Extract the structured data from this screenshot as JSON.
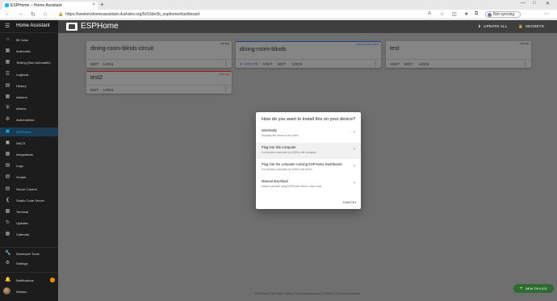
{
  "browser": {
    "tab_title": "ESPHome – Home Assistant",
    "tab_close": "×",
    "new_tab": "+",
    "url": "https://westonshomeassistant.duckdns.org/5c53de3b_esphome/dashboard",
    "sync_label": "Not syncing"
  },
  "sidebar": {
    "title": "Home Assistant",
    "items": [
      {
        "label": "Mi Casa",
        "icon": "home-icon"
      },
      {
        "label": "Automatic",
        "icon": "dashboard-icon"
      },
      {
        "label": "Testing (Non Automatic)",
        "icon": "dashboard-icon"
      },
      {
        "label": "Logbook",
        "icon": "logbook-icon"
      },
      {
        "label": "History",
        "icon": "history-icon"
      },
      {
        "label": "Addons",
        "icon": "dashboard-icon"
      },
      {
        "label": "Alarms",
        "icon": "shield-icon"
      },
      {
        "label": "Automations",
        "icon": "robot-icon"
      },
      {
        "label": "ESPHome",
        "icon": "esphome-icon"
      },
      {
        "label": "HACS",
        "icon": "hacs-icon"
      },
      {
        "label": "Integrations",
        "icon": "puzzle-icon"
      },
      {
        "label": "Logs",
        "icon": "logs-icon"
      },
      {
        "label": "Scripts",
        "icon": "script-icon"
      },
      {
        "label": "Server Control",
        "icon": "server-icon"
      },
      {
        "label": "Studio Code Server",
        "icon": "code-icon"
      },
      {
        "label": "Terminal",
        "icon": "terminal-icon"
      },
      {
        "label": "Updates",
        "icon": "update-icon"
      },
      {
        "label": "Calendar",
        "icon": "calendar-icon"
      }
    ],
    "developer_tools": "Developer Tools",
    "settings": "Settings",
    "notifications": "Notifications",
    "notification_count": "1",
    "user": "Weston"
  },
  "app": {
    "title": "ESPHome",
    "update_all": "UPDATE ALL",
    "secrets": "SECRETS"
  },
  "devices": [
    {
      "name": "dining-room-blinds-circuit",
      "status": "ONLINE",
      "actions": [
        "EDIT",
        "LOGS"
      ]
    },
    {
      "name": "dining-room-blinds",
      "status": "UPDATE AVAILABLE",
      "actions": [
        "UPDATE",
        "VISIT",
        "EDIT",
        "LOGS"
      ]
    },
    {
      "name": "test",
      "status": "ONLINE",
      "actions": [
        "VISIT",
        "EDIT",
        "LOGS"
      ]
    },
    {
      "name": "test2",
      "status": "OFFLINE",
      "actions": [
        "EDIT",
        "LOGS"
      ]
    }
  ],
  "footer": "ESPHome by Nabu Casa | Fund development | v2022.6.3 Documentation",
  "fab_label": "NEW DEVICE",
  "dialog": {
    "title": "How do you want to install this on your device?",
    "options": [
      {
        "title": "Wirelessly",
        "subtitle": "Requires the device to be online"
      },
      {
        "title": "Plug into this computer",
        "subtitle": "For devices connected via USB to this computer"
      },
      {
        "title": "Plug into the computer running ESPHome Dashboard",
        "subtitle": "For devices connected via USB to the server"
      },
      {
        "title": "Manual download",
        "subtitle": "Install it yourself using ESPHome Web or other tools"
      }
    ],
    "cancel": "CANCEL"
  }
}
